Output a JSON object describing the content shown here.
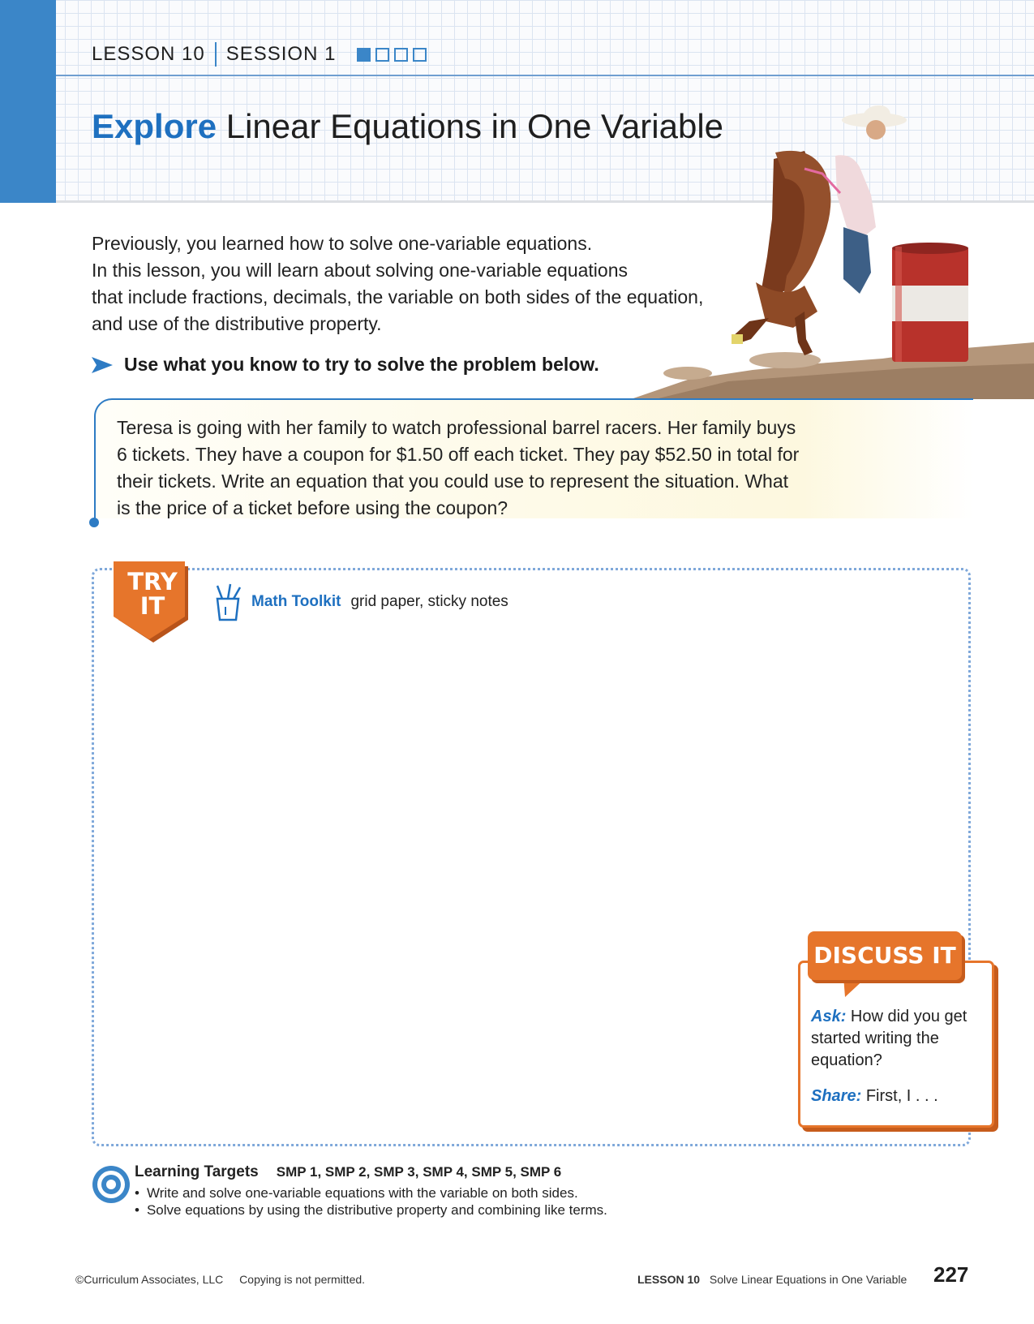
{
  "header": {
    "lesson": "LESSON 10",
    "session": "SESSION 1",
    "session_progress": {
      "current": 1,
      "total": 4
    },
    "title_highlight": "Explore",
    "title_rest": "Linear Equations in One Variable",
    "accent_color": "#3b86c8"
  },
  "intro": {
    "lines": [
      "Previously, you learned how to solve one-variable equations.",
      "In this lesson, you will learn about solving one-variable equations",
      "that include fractions, decimals, the variable on both sides of the equation,",
      "and use of the distributive property."
    ],
    "prompt": "Use what you know to try to solve the problem below."
  },
  "problem": {
    "lines": [
      "Teresa is going with her family to watch professional barrel racers. Her family buys",
      "6 tickets. They have a coupon for $1.50 off each ticket. They pay $52.50 in total for",
      "their tickets. Write an equation that you could use to represent the situation. What",
      "is the price of a ticket before using the coupon?"
    ]
  },
  "try_it": {
    "badge_line1": "TRY",
    "badge_line2": "IT",
    "toolkit_label": "Math Toolkit",
    "toolkit_items": "grid paper, sticky notes",
    "accent_color": "#e6752b"
  },
  "discuss_it": {
    "title": "DISCUSS IT",
    "ask_label": "Ask:",
    "ask_text": "How did you get started writing the equation?",
    "share_label": "Share:",
    "share_text": "First, I  . . ."
  },
  "learning_targets": {
    "title": "Learning Targets",
    "smp": "SMP 1, SMP 2, SMP 3, SMP 4, SMP 5, SMP 6",
    "items": [
      "Write and solve one-variable equations with the variable on both sides.",
      "Solve equations by using the distributive property and combining like terms."
    ]
  },
  "footer": {
    "copyright": "©Curriculum Associates, LLC",
    "notice": "Copying is not permitted.",
    "lesson_label": "LESSON 10",
    "lesson_title": "Solve Linear Equations in One Variable",
    "page_number": "227"
  }
}
